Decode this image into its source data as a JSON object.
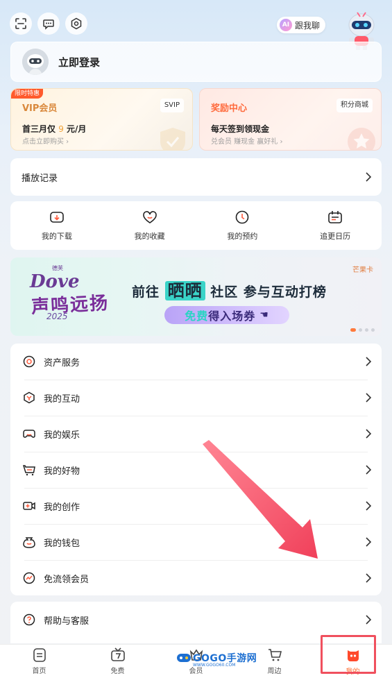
{
  "topbar": {
    "icons": [
      "scan-icon",
      "message-icon",
      "settings-icon"
    ],
    "ai_chip_badge": "AI",
    "ai_chip_label": "跟我聊"
  },
  "login": {
    "label": "立即登录"
  },
  "vip_card": {
    "tag": "限时特惠",
    "title": "VIP会员",
    "chip": "SVIP",
    "main_prefix": "首三月仅",
    "main_price": "9",
    "main_suffix": "元/月",
    "sub": "点击立即购买"
  },
  "reward_card": {
    "title": "奖励中心",
    "chip": "积分商城",
    "main": "每天签到领现金",
    "sub": "兑会员 赚现金 赢好礼"
  },
  "history": {
    "label": "播放记录"
  },
  "quick_actions": [
    {
      "label": "我的下载",
      "icon": "download-icon"
    },
    {
      "label": "我的收藏",
      "icon": "favorite-icon"
    },
    {
      "label": "我的预约",
      "icon": "reminder-icon"
    },
    {
      "label": "追更日历",
      "icon": "calendar-icon"
    }
  ],
  "banner": {
    "brand_small": "德芙",
    "brand": "Dove",
    "slogan": "声鸣远扬",
    "year": "2025",
    "headline_pre": "前往",
    "headline_highlight": "晒晒",
    "headline_post": "社区 参与互动打榜",
    "cta_free": "免费",
    "cta_rest": "得入场券",
    "partner_logos": "芒果卡",
    "dots": 4,
    "active_dot": 0
  },
  "menu": [
    {
      "label": "资产服务",
      "icon": "asset-icon"
    },
    {
      "label": "我的互动",
      "icon": "interaction-icon"
    },
    {
      "label": "我的娱乐",
      "icon": "gamepad-icon"
    },
    {
      "label": "我的好物",
      "icon": "cart-icon"
    },
    {
      "label": "我的创作",
      "icon": "video-create-icon"
    },
    {
      "label": "我的钱包",
      "icon": "wallet-icon"
    },
    {
      "label": "免流领会员",
      "icon": "data-free-icon"
    }
  ],
  "help": {
    "label": "帮助与客服"
  },
  "tabs": [
    {
      "label": "首页",
      "icon": "home-icon",
      "active": false
    },
    {
      "label": "免费",
      "icon": "free-tv-icon",
      "active": false
    },
    {
      "label": "会员",
      "icon": "vip-icon",
      "active": false
    },
    {
      "label": "周边",
      "icon": "shop-icon",
      "active": false
    },
    {
      "label": "我的",
      "icon": "profile-icon",
      "active": true
    }
  ],
  "watermark": {
    "text": "GOGO手游网",
    "sub": "WWW.GOGO60.COM"
  },
  "colors": {
    "accent": "#ff6a2c",
    "annotation": "#f0505e"
  }
}
